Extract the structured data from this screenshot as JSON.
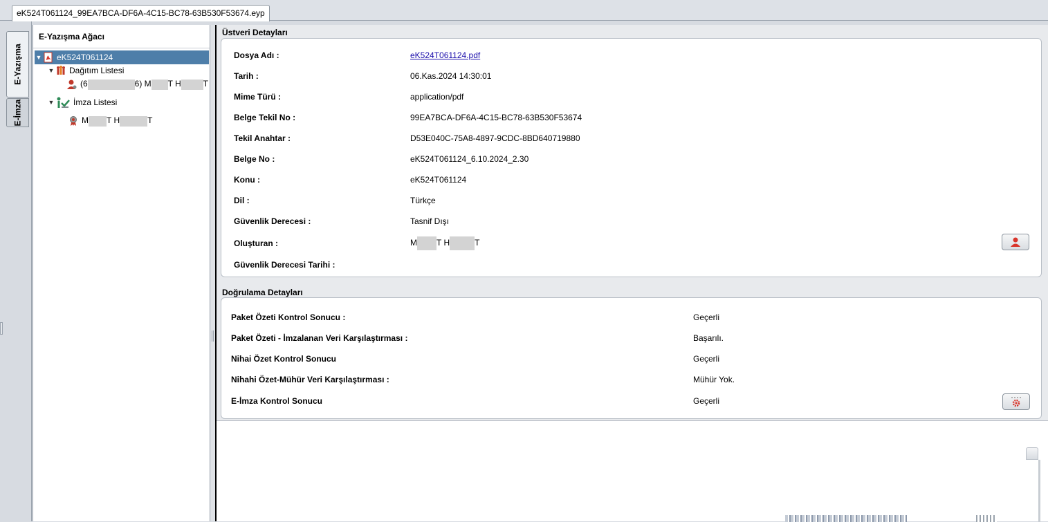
{
  "tab": {
    "label": "eK524T061124_99EA7BCA-DF6A-4C15-BC78-63B530F53674.eyp"
  },
  "side_tabs": {
    "active": "E-Yazışma",
    "inactive": "E-İmza"
  },
  "tree": {
    "header": "E-Yazışma Ağacı",
    "root": "eK524T061124",
    "dist_list": "Dağıtım Listesi",
    "dist_item_a": "(6",
    "dist_item_b": "6) M",
    "dist_item_c": "T H",
    "dist_item_d": "T",
    "sign_list": "İmza Listesi",
    "sign_item_a": "M",
    "sign_item_b": "T H",
    "sign_item_c": "T"
  },
  "metadata": {
    "title": "Üstveri Detayları",
    "rows": [
      {
        "label": "Dosya Adı :",
        "value": "eK524T061124.pdf"
      },
      {
        "label": "Tarih :",
        "value": "06.Kas.2024 14:30:01"
      },
      {
        "label": "Mime Türü :",
        "value": "application/pdf"
      },
      {
        "label": "Belge Tekil No :",
        "value": "99EA7BCA-DF6A-4C15-BC78-63B530F53674"
      },
      {
        "label": "Tekil Anahtar :",
        "value": "D53E040C-75A8-4897-9CDC-8BD640719880"
      },
      {
        "label": "Belge No :",
        "value": "eK524T061124_6.10.2024_2.30"
      },
      {
        "label": "Konu :",
        "value": "eK524T061124"
      },
      {
        "label": "Dil :",
        "value": "Türkçe"
      },
      {
        "label": "Güvenlik Derecesi :",
        "value": "Tasnif Dışı"
      },
      {
        "label": "Oluşturan :",
        "value_a": "M",
        "value_b": "T H",
        "value_c": "T"
      },
      {
        "label": "Güvenlik Derecesi Tarihi :",
        "value": ""
      }
    ],
    "person_icon": "user-icon"
  },
  "verification": {
    "title": "Doğrulama Detayları",
    "rows": [
      {
        "label": "Paket Özeti Kontrol Sonucu :",
        "value": "Geçerli"
      },
      {
        "label": "Paket Özeti - İmzalanan Veri Karşılaştırması :",
        "value": "Başarılı."
      },
      {
        "label": "Nihai Özet Kontrol Sonucu",
        "value": "Geçerli"
      },
      {
        "label": "Nihahi Özet-Mühür Veri Karşılaştırması :",
        "value": "Mühür Yok."
      },
      {
        "label": "E-İmza Kontrol Sonucu",
        "value": "Geçerli"
      }
    ],
    "settings_icon": "gear-icon"
  },
  "colors": {
    "selection": "#4e7ea9",
    "link": "#1a0dab",
    "accent_red": "#d9352b"
  }
}
